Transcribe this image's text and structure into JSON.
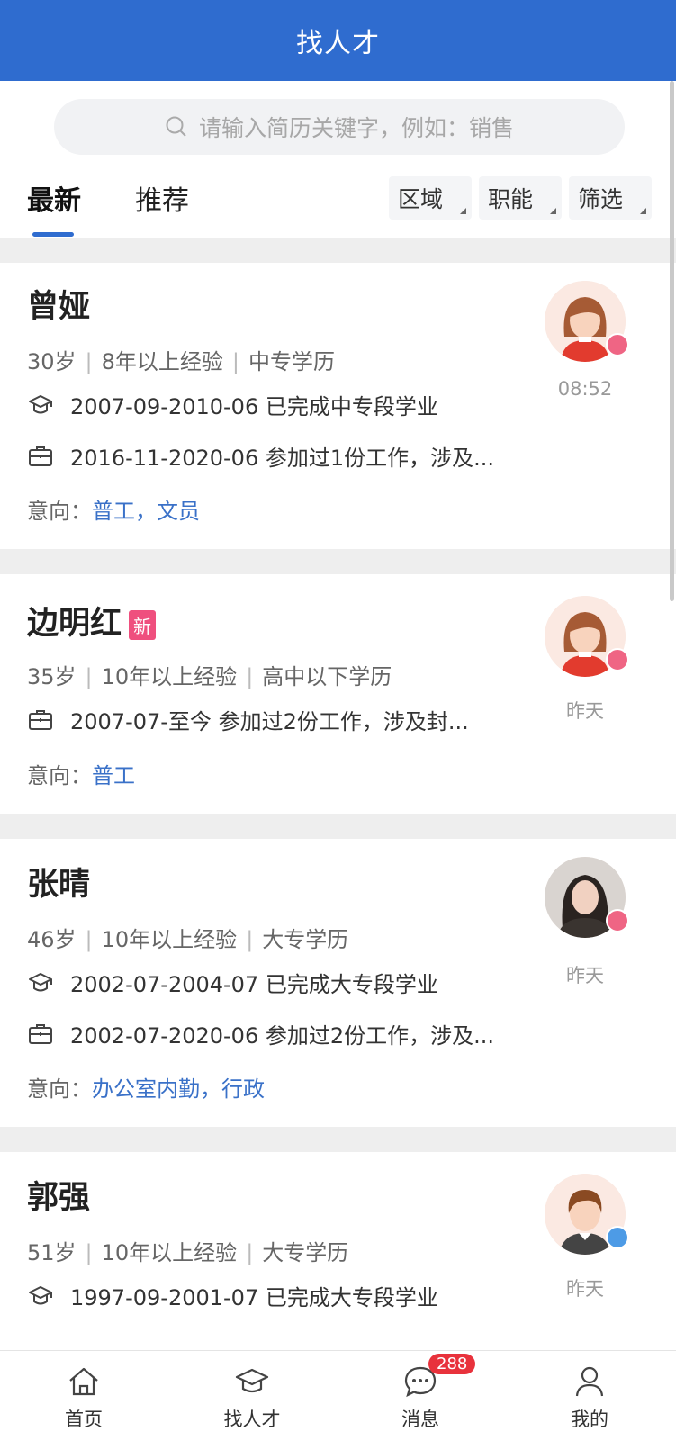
{
  "header": {
    "title": "找人才"
  },
  "search": {
    "placeholder": "请输入简历关键字，例如：销售"
  },
  "tabs": [
    {
      "label": "最新"
    },
    {
      "label": "推荐"
    }
  ],
  "filters": [
    {
      "label": "区域"
    },
    {
      "label": "职能"
    },
    {
      "label": "筛选"
    }
  ],
  "candidates": [
    {
      "name": "曾娅",
      "age": "30岁",
      "experience": "8年以上经验",
      "education": "中专学历",
      "edu_line": "2007-09-2010-06 已完成中专段学业",
      "work_line": "2016-11-2020-06 参加过1份工作，涉及...",
      "intent_label": "意向：",
      "intent": "普工，文员",
      "time": "08:52",
      "gender": "female"
    },
    {
      "name": "边明红",
      "badge": "新",
      "age": "35岁",
      "experience": "10年以上经验",
      "education": "高中以下学历",
      "work_line": "2007-07-至今 参加过2份工作，涉及封...",
      "intent_label": "意向：",
      "intent": "普工",
      "time": "昨天",
      "gender": "female"
    },
    {
      "name": "张晴",
      "age": "46岁",
      "experience": "10年以上经验",
      "education": "大专学历",
      "edu_line": "2002-07-2004-07 已完成大专段学业",
      "work_line": "2002-07-2020-06 参加过2份工作，涉及...",
      "intent_label": "意向：",
      "intent": "办公室内勤，行政",
      "time": "昨天",
      "gender": "female"
    },
    {
      "name": "郭强",
      "age": "51岁",
      "experience": "10年以上经验",
      "education": "大专学历",
      "edu_line": "1997-09-2001-07 已完成大专段学业",
      "time": "昨天",
      "gender": "male"
    }
  ],
  "nav": {
    "home": "首页",
    "talent": "找人才",
    "messages": "消息",
    "mine": "我的",
    "message_count": "288"
  },
  "colors": {
    "brand": "#2f6ccf",
    "intent": "#3a71c8",
    "badge_new": "#ef4f7e",
    "count": "#e8323c"
  }
}
